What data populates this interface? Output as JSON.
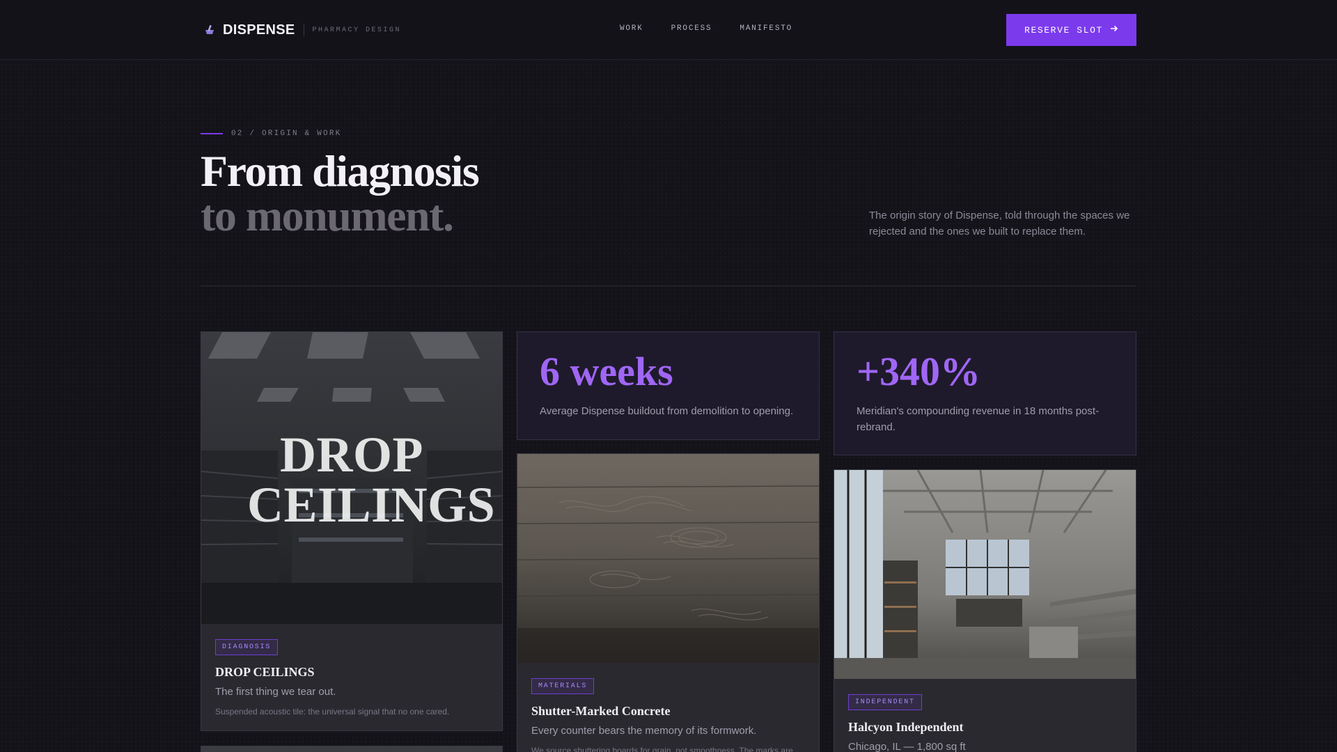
{
  "nav": {
    "brand": "DISPENSE",
    "brand_sub": "PHARMACY DESIGN",
    "links": [
      "WORK",
      "PROCESS",
      "MANIFESTO"
    ],
    "cta": "RESERVE SLOT",
    "accent": "#7c3aed"
  },
  "hero": {
    "eyebrow": "02 / ORIGIN & WORK",
    "title_line1": "From diagnosis",
    "title_line2": "to monument.",
    "description": "The origin story of Dispense, told through the spaces we rejected and the ones we built to replace them."
  },
  "cards": {
    "drop": {
      "overlay": "DROP CEILINGS",
      "tag": "DIAGNOSIS",
      "title": "DROP CEILINGS",
      "subtitle": "The first thing we tear out.",
      "note": "Suspended acoustic tile: the universal signal that no one cared."
    },
    "stat1": {
      "value": "6 weeks",
      "desc": "Average Dispense buildout from demolition to opening."
    },
    "stat2": {
      "value": "+340%",
      "desc": "Meridian's compounding revenue in 18 months post-rebrand."
    },
    "concrete": {
      "tag": "MATERIALS",
      "title": "Shutter-Marked Concrete",
      "subtitle": "Every counter bears the memory of its formwork.",
      "note": "We source shuttering boards for grain, not smoothness. The marks are"
    },
    "halcyon": {
      "tag": "INDEPENDENT",
      "title": "Halcyon Independent",
      "subtitle": "Chicago, IL — 1,800 sq ft"
    }
  }
}
